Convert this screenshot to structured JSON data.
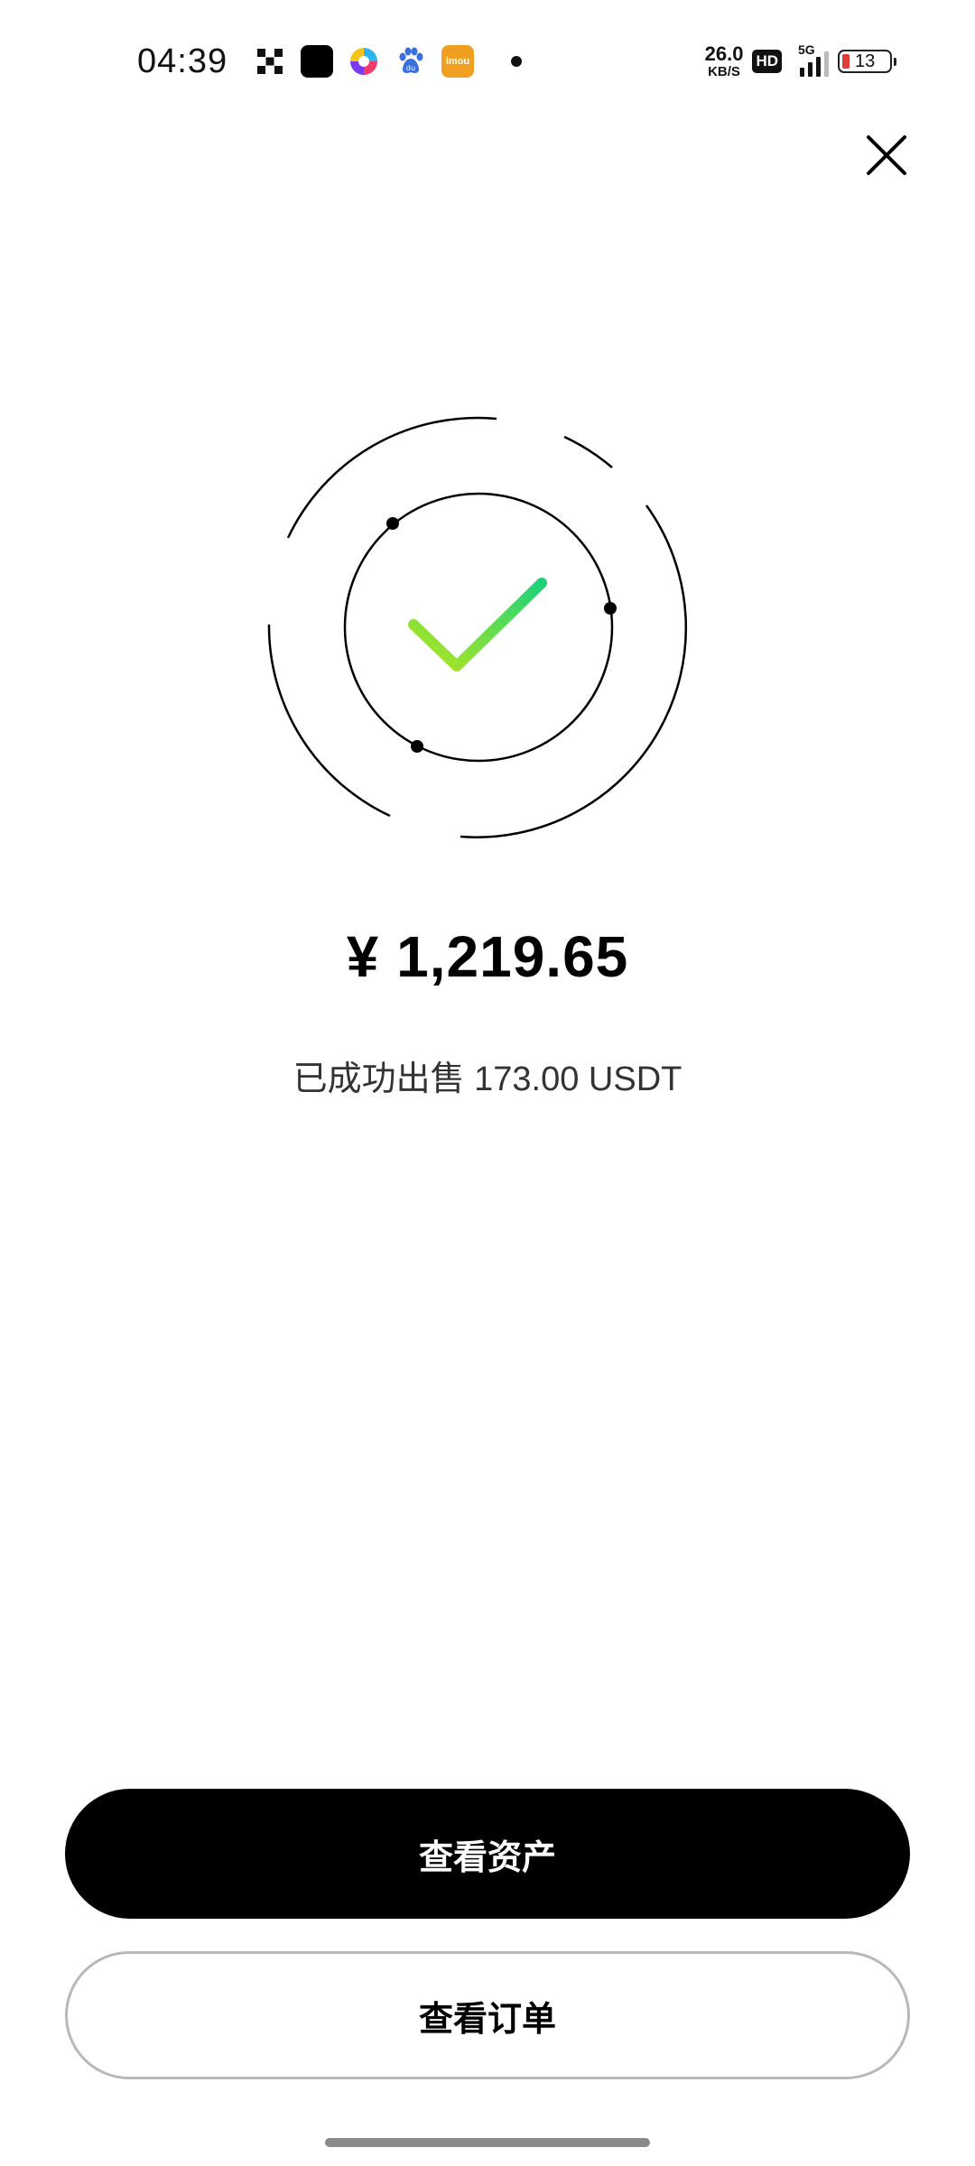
{
  "status_bar": {
    "time": "04:39",
    "net_speed_value": "26.0",
    "net_speed_unit": "KB/S",
    "hd_label": "HD",
    "network_type": "5G",
    "battery_level": "13",
    "notification_icons": [
      "okx-app-icon",
      "black-app-icon",
      "colorful-app-icon",
      "baidu-icon",
      "imou-app-icon"
    ],
    "imou_label": "imou"
  },
  "result": {
    "amount": "¥ 1,219.65",
    "message": "已成功出售 173.00 USDT",
    "accent_gradient": [
      "#b4e61e",
      "#1ed27a"
    ]
  },
  "actions": {
    "primary_label": "查看资产",
    "secondary_label": "查看订单"
  }
}
